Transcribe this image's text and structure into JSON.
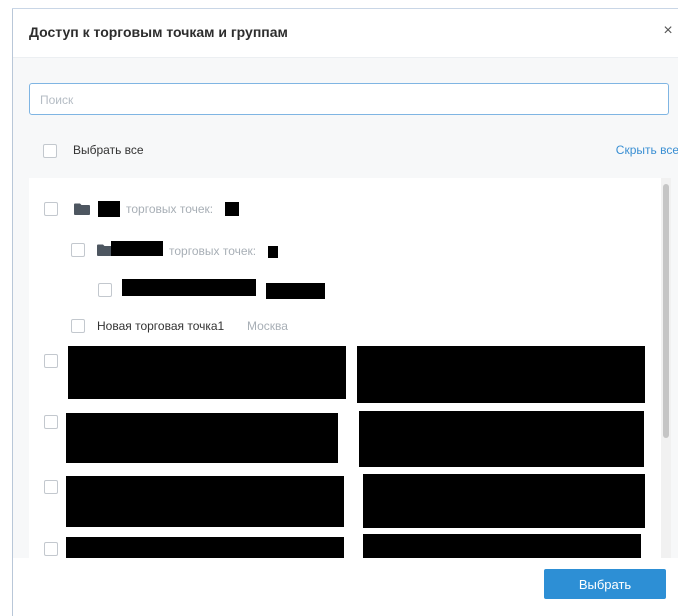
{
  "dialog": {
    "title": "Доступ к торговым точкам и группам",
    "close_glyph": "×",
    "close_icon": "close-icon"
  },
  "search": {
    "placeholder": "Поиск",
    "value": ""
  },
  "select_all": {
    "label": "Выбрать все",
    "checked": false
  },
  "hide_all_label": "Скрыть все",
  "tree": {
    "group1": {
      "suffix": "торговых точек:",
      "icon": "folder-icon",
      "checked": false
    },
    "group2": {
      "suffix": "торговых точек:",
      "icon": "folder-icon",
      "checked": false
    },
    "point1": {
      "checked": false
    },
    "point2": {
      "name": "Новая торговая точка1",
      "city": "Москва",
      "checked": false
    }
  },
  "colors": {
    "accent": "#2d8fd5",
    "link": "#3a8fd3",
    "search_border": "#7fb5e3",
    "folder": "#4d5660",
    "redaction": "#000000"
  },
  "footer": {
    "submit_label": "Выбрать"
  }
}
